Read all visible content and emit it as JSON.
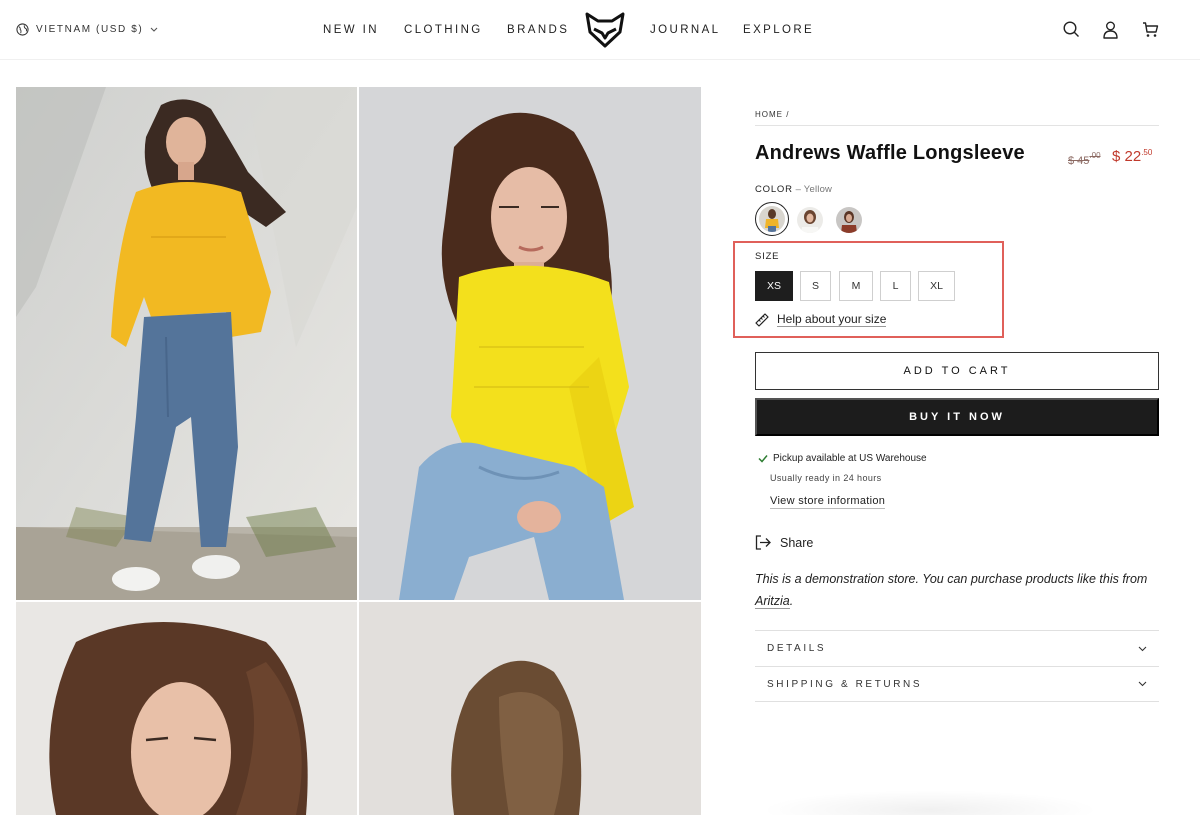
{
  "header": {
    "locale": "VIETNAM (USD $)",
    "nav": [
      "NEW IN",
      "CLOTHING",
      "BRANDS",
      "JOURNAL",
      "EXPLORE"
    ]
  },
  "breadcrumb": "HOME /",
  "product": {
    "title": "Andrews Waffle Longsleeve",
    "old_price_main": "$ 45",
    "old_price_cents": ".00",
    "price_main": "$ 22",
    "price_cents": ".50"
  },
  "color": {
    "label": "COLOR",
    "separator": " – ",
    "value": "Yellow"
  },
  "size": {
    "label": "SIZE",
    "options": [
      "XS",
      "S",
      "M",
      "L",
      "XL"
    ],
    "selected": "XS",
    "help": "Help about your size"
  },
  "buttons": {
    "add_to_cart": "ADD TO CART",
    "buy_now": "BUY IT NOW"
  },
  "pickup": {
    "status": "Pickup available at US Warehouse",
    "ready": "Usually ready in 24 hours",
    "store_link": "View store information"
  },
  "share": "Share",
  "demo": {
    "text": "This is a demonstration store. You can purchase products like this from ",
    "link": "Aritzia",
    "end": "."
  },
  "accordion": [
    "DETAILS",
    "SHIPPING & RETURNS"
  ],
  "colors": {
    "accent_red": "#c0392b",
    "highlight_border": "#e0605a",
    "button_dark": "#1c1c1c"
  }
}
